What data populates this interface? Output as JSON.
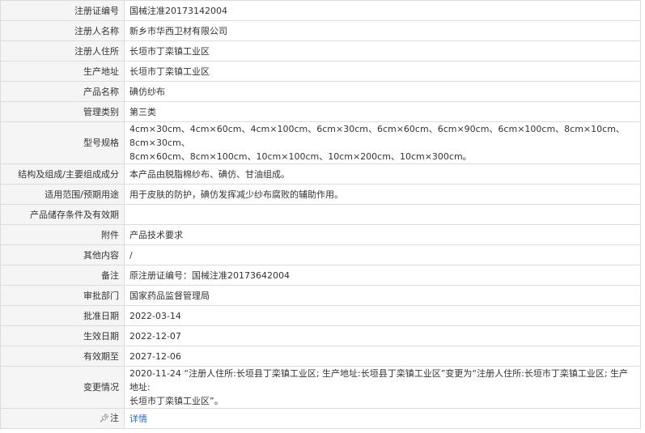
{
  "rows": [
    {
      "label": "注册证编号",
      "value": "国械注准20173142004"
    },
    {
      "label": "注册人名称",
      "value": "新乡市华西卫材有限公司"
    },
    {
      "label": "注册人住所",
      "value": "长垣市丁栾镇工业区"
    },
    {
      "label": "生产地址",
      "value": "长垣市丁栾镇工业区"
    },
    {
      "label": "产品名称",
      "value": "碘仿纱布"
    },
    {
      "label": "管理类别",
      "value": "第三类"
    },
    {
      "label": "型号规格",
      "value_line1": "4cm×30cm、4cm×60cm、4cm×100cm、6cm×30cm、6cm×60cm、6cm×90cm、6cm×100cm、8cm×10cm、8cm×30cm、",
      "value_line2": "8cm×60cm、8cm×100cm、10cm×100cm、10cm×200cm、10cm×300cm。"
    },
    {
      "label": "结构及组成/主要组成成分",
      "value": "本产品由脱脂棉纱布、碘仿、甘油组成。"
    },
    {
      "label": "适用范围/预期用途",
      "value": "用于皮肤的防护，碘仿发挥减少纱布腐败的辅助作用。"
    },
    {
      "label": "产品储存条件及有效期",
      "value": ""
    },
    {
      "label": "附件",
      "value": "产品技术要求"
    },
    {
      "label": "其他内容",
      "value": "/"
    },
    {
      "label": "备注",
      "value": "原注册证编号：国械注准20173642004"
    },
    {
      "label": "审批部门",
      "value": "国家药品监督管理局"
    },
    {
      "label": "批准日期",
      "value": "2022-03-14"
    },
    {
      "label": "生效日期",
      "value": "2022-12-07"
    },
    {
      "label": "有效期至",
      "value": "2027-12-06"
    },
    {
      "label": "变更情况",
      "value_line1": "2020-11-24 “注册人住所:长垣县丁栾镇工业区; 生产地址:长垣县丁栾镇工业区”变更为“注册人住所:长垣市丁栾镇工业区; 生产地址:",
      "value_line2": "长垣市丁栾镇工业区”。"
    },
    {
      "label": "注",
      "value": "详情"
    }
  ],
  "icons": {
    "note_label_icon": "pin-icon"
  }
}
